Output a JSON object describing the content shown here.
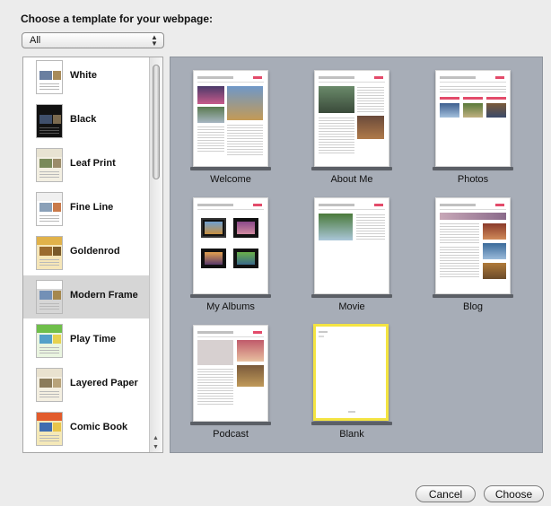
{
  "dialog": {
    "title": "Choose a template for your webpage:",
    "filter_value": "All",
    "cancel_label": "Cancel",
    "choose_label": "Choose"
  },
  "templates": [
    {
      "label": "White",
      "band": "#ffffff",
      "pic": "#6a7fa0",
      "pic2": "#a88b5a"
    },
    {
      "label": "Black",
      "band": "#111111",
      "pic": "#3f4f6b",
      "pic2": "#7b6a4f"
    },
    {
      "label": "Leaf Print",
      "band": "#e8e3d2",
      "pic": "#7a8a5a",
      "pic2": "#9b8c6a"
    },
    {
      "label": "Fine Line",
      "band": "#f0f0f0",
      "pic": "#8aa0b8",
      "pic2": "#c97a4a"
    },
    {
      "label": "Goldenrod",
      "band": "#e1b24a",
      "pic": "#9b6b2f",
      "pic2": "#7a5a2a"
    },
    {
      "label": "Modern Frame",
      "band": "#ffffff",
      "pic": "#7390b6",
      "pic2": "#a5884e"
    },
    {
      "label": "Play Time",
      "band": "#6fbf4a",
      "pic": "#54a0c9",
      "pic2": "#e7d24f"
    },
    {
      "label": "Layered Paper",
      "band": "#e9e2cf",
      "pic": "#8b7b5a",
      "pic2": "#b8a37a"
    },
    {
      "label": "Comic Book",
      "band": "#e25b2c",
      "pic": "#3f6db0",
      "pic2": "#e8c54a"
    }
  ],
  "pages": [
    {
      "label": "Welcome"
    },
    {
      "label": "About Me"
    },
    {
      "label": "Photos"
    },
    {
      "label": "My Albums"
    },
    {
      "label": "Movie"
    },
    {
      "label": "Blog"
    },
    {
      "label": "Podcast"
    },
    {
      "label": "Blank"
    }
  ],
  "colors": {
    "grid_background": "#a7adb7",
    "selected_page_border": "#f4e442",
    "accent_pink": "#e34b6a"
  }
}
